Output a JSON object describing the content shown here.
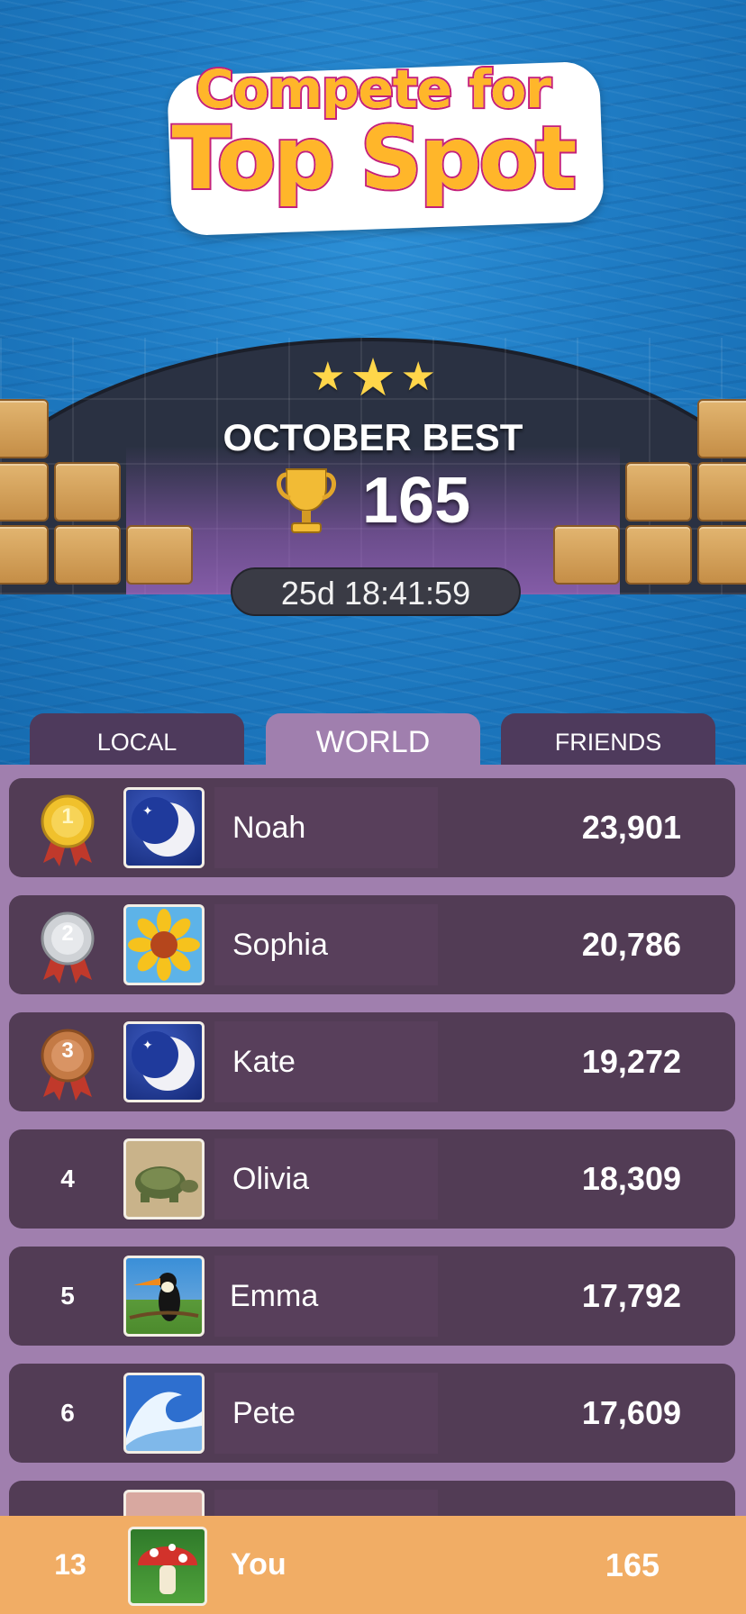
{
  "header": {
    "title_line1": "Compete for",
    "title_line2": "Top Spot"
  },
  "best": {
    "label": "OCTOBER BEST",
    "score": "165",
    "timer": "25d 18:41:59"
  },
  "tabs": [
    {
      "label": "LOCAL",
      "active": false
    },
    {
      "label": "WORLD",
      "active": true
    },
    {
      "label": "FRIENDS",
      "active": false
    }
  ],
  "leaderboard": [
    {
      "rank": "1",
      "medal": "gold-medal",
      "avatar": "moon-avatar",
      "name": "Noah",
      "score": "23,901"
    },
    {
      "rank": "2",
      "medal": "silver-medal",
      "avatar": "sunflower-avatar",
      "name": "Sophia",
      "score": "20,786"
    },
    {
      "rank": "3",
      "medal": "bronze-medal",
      "avatar": "moon-avatar",
      "name": "Kate",
      "score": "19,272"
    },
    {
      "rank": "4",
      "avatar": "turtle-avatar",
      "name": "Olivia",
      "score": "18,309"
    },
    {
      "rank": "5",
      "avatar": "toucan-avatar",
      "name": "Emma",
      "score": "17,792"
    },
    {
      "rank": "6",
      "avatar": "wave-avatar",
      "name": "Pete",
      "score": "17,609"
    }
  ],
  "you": {
    "rank": "13",
    "avatar": "mushroom-avatar",
    "name": "You",
    "score": "165"
  },
  "colors": {
    "panel": "#a07fae",
    "row": "#523c55",
    "tab_inactive": "#4e3a5c",
    "you_bar": "#f1ad65",
    "title_fill": "#ffb62a",
    "title_stroke": "#c4207a"
  }
}
